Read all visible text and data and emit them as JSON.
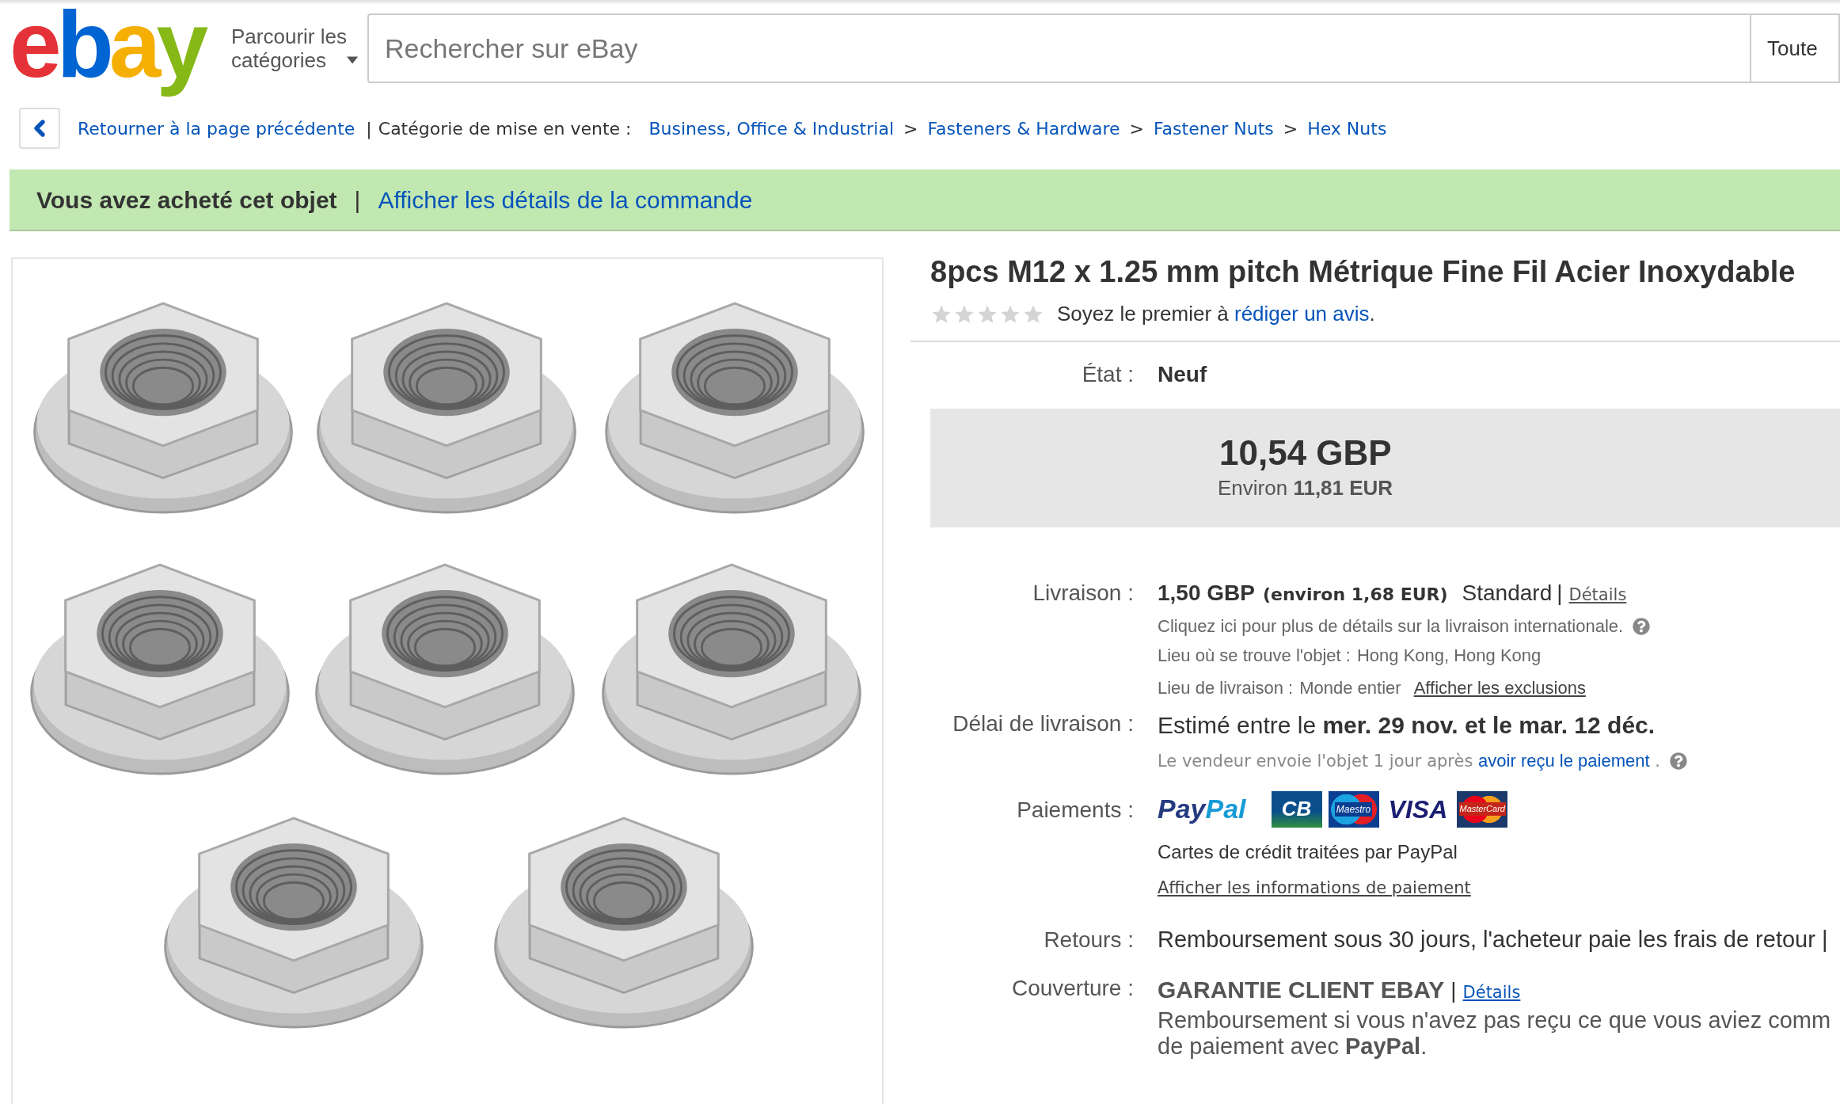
{
  "header": {
    "logo": [
      {
        "char": "e",
        "color": "#e53238"
      },
      {
        "char": "b",
        "color": "#0064d2"
      },
      {
        "char": "a",
        "color": "#f5af02"
      },
      {
        "char": "y",
        "color": "#86b817"
      }
    ],
    "categories_button": "Parcourir les catégories",
    "search": {
      "placeholder": "Rechercher sur eBay"
    },
    "category_dropdown": "Toute"
  },
  "breadcrumb": {
    "back_link": "Retourner à la page précédente",
    "separator": "|",
    "label": "Catégorie de mise en vente :",
    "items": [
      {
        "label": "Business, Office & Industrial",
        "separator": ">"
      },
      {
        "label": "Fasteners & Hardware",
        "separator": ">"
      },
      {
        "label": "Fastener Nuts",
        "separator": ">"
      },
      {
        "label": "Hex Nuts"
      }
    ]
  },
  "banner": {
    "message": "Vous avez acheté cet objet",
    "separator": "|",
    "link": "Afficher les détails de la commande"
  },
  "product": {
    "title": "8pcs M12 x 1.25 mm pitch Métrique Fine Fil Acier Inoxydable",
    "rating": {
      "stars": 0,
      "prompt": "Soyez le premier à",
      "link": "rédiger un avis",
      "end": "."
    },
    "condition": {
      "label": "État :",
      "value": "Neuf"
    },
    "price": {
      "amount": "10,54 GBP",
      "converted": "Environ **11,81 EUR**"
    },
    "shipping": {
      "label": "Livraison :",
      "cost": "1,50 GBP",
      "converted": "(environ 1,68 EUR)",
      "service": "Standard",
      "separator": "|",
      "details_link": "Détails",
      "info": "Cliquez ici pour plus de détails sur la livraison internationale.",
      "location_label": "Lieu où se trouve l'objet :",
      "location": "Hong Kong, Hong Kong",
      "ships_to_label": "Lieu de livraison :",
      "ships_to": "Monde entier",
      "exclusions_link": "Afficher les exclusions"
    },
    "delivery": {
      "label": "Délai de livraison :",
      "estimate": "Estimé entre le **mer. 29 nov. et le mar. 12 déc.**",
      "handling": "Le vendeur envoie l'objet 1 jour après",
      "handling_link": "avoir reçu le paiement",
      "handling_end": "."
    },
    "payments": {
      "label": "Paiements :",
      "methods": [
        {
          "kind": "paypal",
          "label": "PayPal"
        },
        {
          "kind": "cb",
          "label": "CB"
        },
        {
          "kind": "maestro",
          "label": "Maestro"
        },
        {
          "kind": "visa",
          "label": "VISA"
        },
        {
          "kind": "mastercard",
          "label": "MasterCard"
        }
      ],
      "note": "Cartes de crédit traitées par PayPal",
      "info_link": "Afficher les informations de paiement"
    },
    "returns": {
      "label": "Retours :",
      "text": "Remboursement sous 30 jours, l'acheteur paie les frais de retour |"
    },
    "coverage": {
      "label": "Couverture :",
      "title": "GARANTIE CLIENT EBAY",
      "separator": "|",
      "details_link": "Détails",
      "lines": [
        "Remboursement si vous n'avez pas reçu ce que vous aviez comm",
        "de paiement avec **PayPal**."
      ]
    }
  }
}
